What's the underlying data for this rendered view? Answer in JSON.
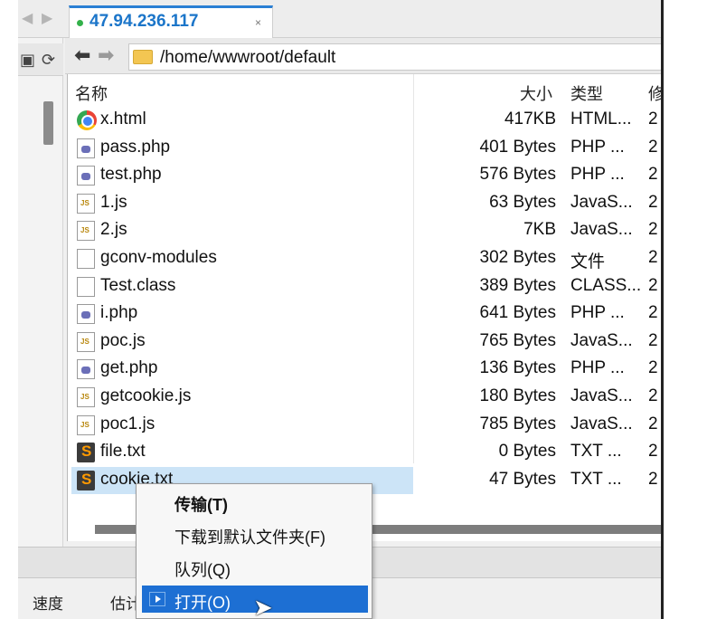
{
  "tab": {
    "title": "47.94.236.117",
    "close": "×"
  },
  "address": {
    "path": "/home/wwwroot/default"
  },
  "columns": {
    "name": "名称",
    "size": "大小",
    "type": "类型",
    "modified": "修"
  },
  "files": [
    {
      "name": "x.html",
      "size": "417KB",
      "type": "HTML...",
      "mod": "2",
      "icon": "chrome-icon"
    },
    {
      "name": "pass.php",
      "size": "401 Bytes",
      "type": "PHP ...",
      "mod": "2",
      "icon": "php-file-icon"
    },
    {
      "name": "test.php",
      "size": "576 Bytes",
      "type": "PHP ...",
      "mod": "2",
      "icon": "php-file-icon"
    },
    {
      "name": "1.js",
      "size": "63 Bytes",
      "type": "JavaS...",
      "mod": "2",
      "icon": "js-file-icon"
    },
    {
      "name": "2.js",
      "size": "7KB",
      "type": "JavaS...",
      "mod": "2",
      "icon": "js-file-icon"
    },
    {
      "name": "gconv-modules",
      "size": "302 Bytes",
      "type": "文件",
      "mod": "2",
      "icon": "file-icon"
    },
    {
      "name": "Test.class",
      "size": "389 Bytes",
      "type": "CLASS...",
      "mod": "2",
      "icon": "file-icon"
    },
    {
      "name": "i.php",
      "size": "641 Bytes",
      "type": "PHP ...",
      "mod": "2",
      "icon": "php-file-icon"
    },
    {
      "name": "poc.js",
      "size": "765 Bytes",
      "type": "JavaS...",
      "mod": "2",
      "icon": "js-file-icon"
    },
    {
      "name": "get.php",
      "size": "136 Bytes",
      "type": "PHP ...",
      "mod": "2",
      "icon": "php-file-icon"
    },
    {
      "name": "getcookie.js",
      "size": "180 Bytes",
      "type": "JavaS...",
      "mod": "2",
      "icon": "js-file-icon"
    },
    {
      "name": "poc1.js",
      "size": "785 Bytes",
      "type": "JavaS...",
      "mod": "2",
      "icon": "js-file-icon"
    },
    {
      "name": "file.txt",
      "size": "0 Bytes",
      "type": "TXT ...",
      "mod": "2",
      "icon": "sublime-icon"
    },
    {
      "name": "cookie.txt",
      "size": "47 Bytes",
      "type": "TXT ...",
      "mod": "2",
      "icon": "sublime-icon",
      "selected": true
    }
  ],
  "context_menu": [
    {
      "label": "传输(T)"
    },
    {
      "label": "下载到默认文件夹(F)"
    },
    {
      "label": "队列(Q)"
    },
    {
      "label": "打开(O)"
    }
  ],
  "status": {
    "speed": "速度",
    "estimate": "估计"
  },
  "colors": {
    "accent": "#1b75c9",
    "menu_highlight": "#1d6fd3",
    "selection": "#cce4f7"
  }
}
